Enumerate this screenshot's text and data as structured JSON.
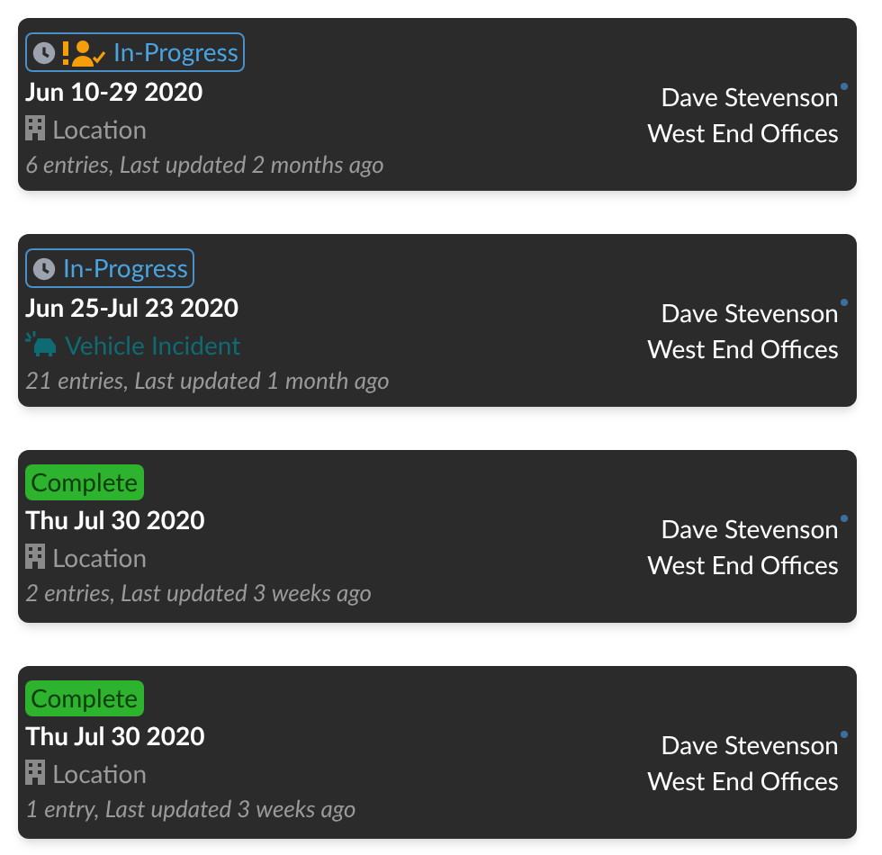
{
  "cards": [
    {
      "status": {
        "kind": "in_progress",
        "label": "In-Progress"
      },
      "assigned": true,
      "date": "Jun 10-29 2020",
      "category": {
        "kind": "location",
        "label": "Location"
      },
      "summary": "6 entries, Last updated 2 months ago",
      "person": "Dave Stevenson",
      "site": "West End Offices"
    },
    {
      "status": {
        "kind": "in_progress",
        "label": "In-Progress"
      },
      "assigned": false,
      "date": "Jun 25-Jul 23 2020",
      "category": {
        "kind": "vehicle",
        "label": "Vehicle Incident"
      },
      "summary": "21 entries, Last updated 1 month ago",
      "person": "Dave Stevenson",
      "site": "West End Offices"
    },
    {
      "status": {
        "kind": "complete",
        "label": "Complete"
      },
      "assigned": false,
      "date": "Thu Jul 30 2020",
      "category": {
        "kind": "location",
        "label": "Location"
      },
      "summary": "2 entries, Last updated 3 weeks ago",
      "person": "Dave Stevenson",
      "site": "West End Offices"
    },
    {
      "status": {
        "kind": "complete",
        "label": "Complete"
      },
      "assigned": false,
      "date": "Thu Jul 30 2020",
      "category": {
        "kind": "location",
        "label": "Location"
      },
      "summary": "1 entry, Last updated 3 weeks ago",
      "person": "Dave Stevenson",
      "site": "West End Offices"
    }
  ]
}
